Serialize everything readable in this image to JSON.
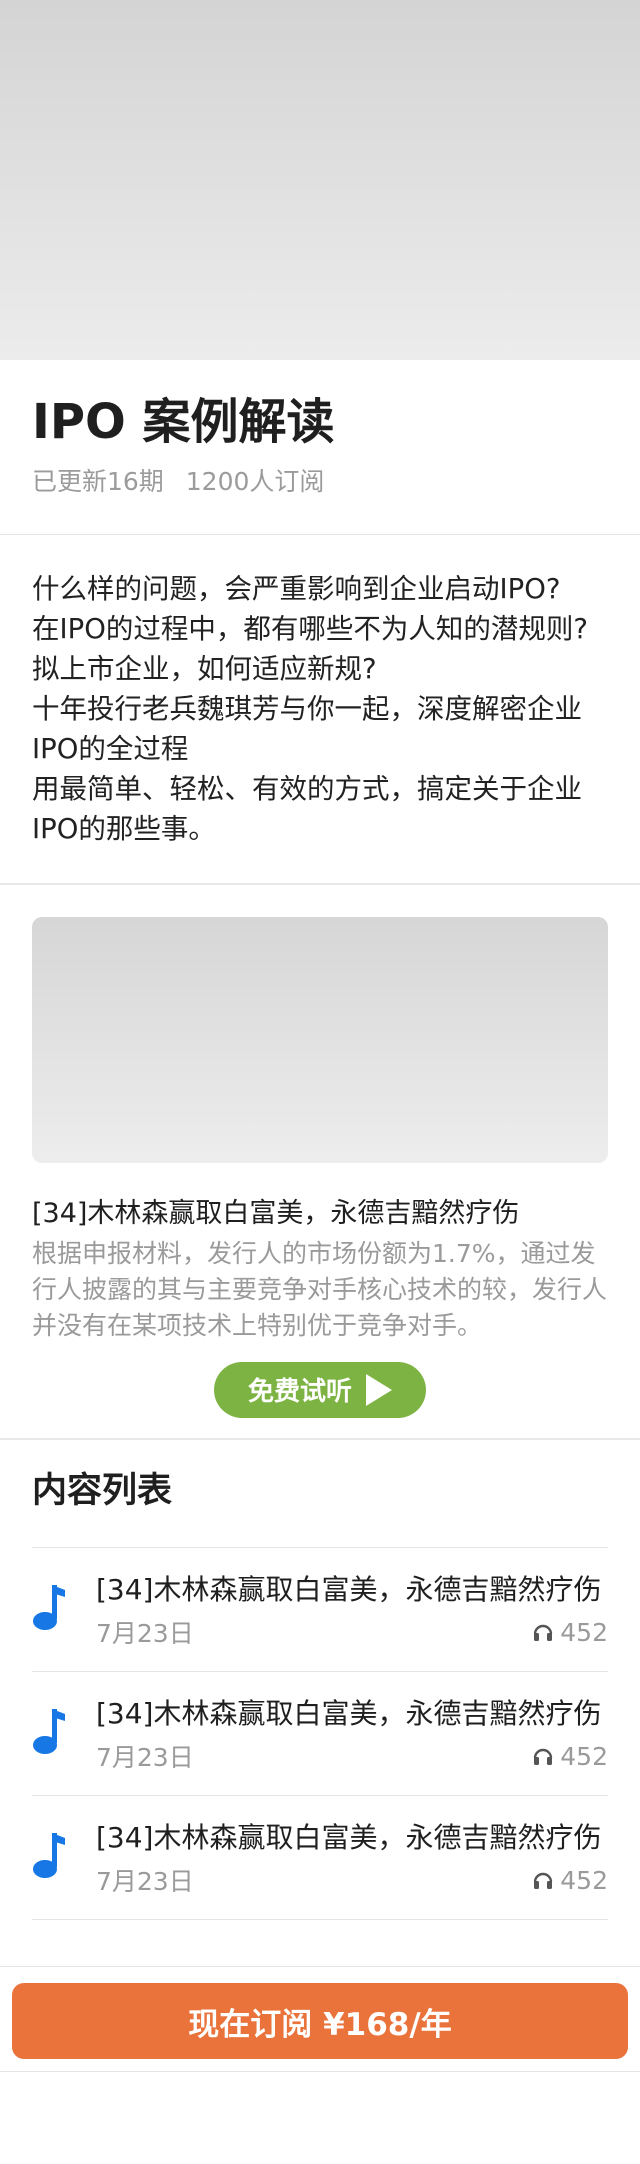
{
  "course": {
    "title": "IPO 案例解读",
    "updated": "已更新16期",
    "subscribers": "1200人订阅"
  },
  "description": [
    "什么样的问题，会严重影响到企业启动IPO?",
    "在IPO的过程中，都有哪些不为人知的潜规则?",
    "拟上市企业，如何适应新规?",
    "十年投行老兵魏琪芳与你一起，深度解密企业IPO的全过程",
    "用最简单、轻松、有效的方式，搞定关于企业IPO的那些事。"
  ],
  "trial": {
    "episode_title": "[34]木林森赢取白富美，永德吉黯然疗伤",
    "summary": "根据申报材料，发行人的市场份额为1.7%，通过发行人披露的其与主要竞争对手核心技术的较，发行人并没有在某项技术上特别优于竞争对手。",
    "listen_label": "免费试听"
  },
  "list": {
    "heading": "内容列表",
    "items": [
      {
        "title": "[34]木林森赢取白富美，永德吉黯然疗伤",
        "date": "7月23日",
        "plays": "452"
      },
      {
        "title": "[34]木林森赢取白富美，永德吉黯然疗伤",
        "date": "7月23日",
        "plays": "452"
      },
      {
        "title": "[34]木林森赢取白富美，永德吉黯然疗伤",
        "date": "7月23日",
        "plays": "452"
      }
    ]
  },
  "subscribe": {
    "label": "现在订阅 ¥168/年"
  },
  "colors": {
    "accent_orange": "#e9733a",
    "listen_green": "#7cb342",
    "note_blue": "#1677e5"
  },
  "icons": {
    "list_item": "music-note-icon",
    "plays": "headphones-icon",
    "listen": "play-icon"
  }
}
